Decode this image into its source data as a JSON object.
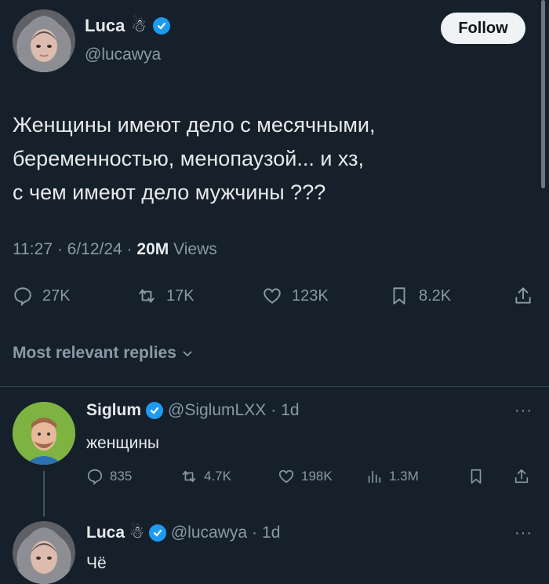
{
  "main_tweet": {
    "author_name": "Luca",
    "author_emoji": "☃",
    "handle": "@lucawya",
    "follow_label": "Follow",
    "text_lines": [
      "Женщины имеют дело с месячными,",
      "беременностью, менопаузой... и хз,",
      "с чем имеют дело мужчины ???"
    ],
    "time": "11:27",
    "date": "6/12/24",
    "views_count": "20M",
    "views_label": "Views",
    "replies": "27K",
    "reposts": "17K",
    "likes": "123K",
    "bookmarks": "8.2K"
  },
  "sort": {
    "label": "Most relevant replies"
  },
  "replies": [
    {
      "author_name": "Siglum",
      "handle": "@SiglumLXX",
      "age": "1d",
      "text": "женщины",
      "replies": "835",
      "reposts": "4.7K",
      "likes": "198K",
      "views": "1.3M"
    },
    {
      "author_name": "Luca",
      "author_emoji": "☃",
      "handle": "@lucawya",
      "age": "1d",
      "text": "Чё"
    }
  ],
  "colors": {
    "background": "#15202b",
    "text": "#e7e9ea",
    "muted": "#8b98a5",
    "verified": "#1d9bf0",
    "divider": "#38444d"
  }
}
